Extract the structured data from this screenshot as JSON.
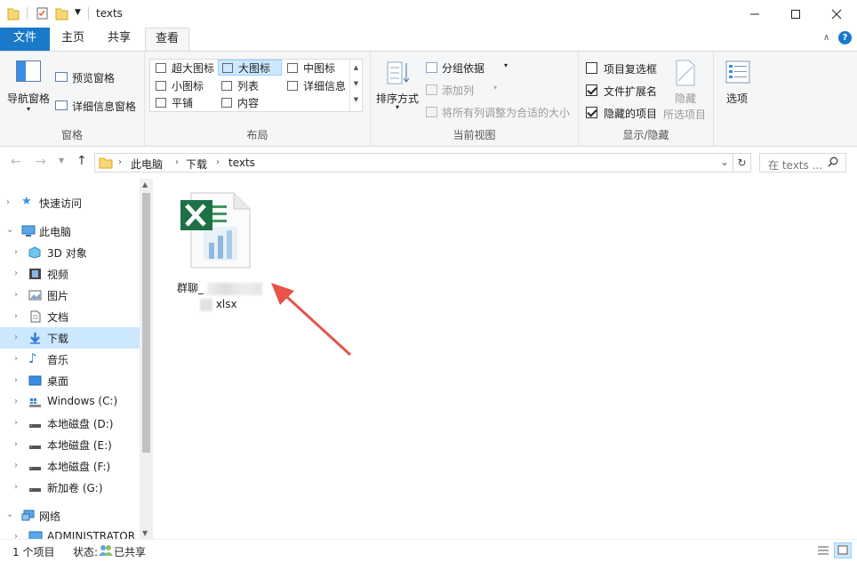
{
  "window": {
    "title": "texts"
  },
  "ribbon_tabs": [
    {
      "label": "文件"
    },
    {
      "label": "主页"
    },
    {
      "label": "共享"
    },
    {
      "label": "查看"
    }
  ],
  "ribbon": {
    "panes": {
      "nav_pane": "导航窗格",
      "preview_pane": "预览窗格",
      "details_pane": "详细信息窗格",
      "group_label": "窗格"
    },
    "layout": {
      "items": [
        "超大图标",
        "大图标",
        "中图标",
        "小图标",
        "列表",
        "详细信息",
        "平铺",
        "内容"
      ],
      "selected": "大图标",
      "group_label": "布局"
    },
    "current_view": {
      "sort_by": "排序方式",
      "group_by": "分组依据",
      "add_column": "添加列",
      "fit_columns": "将所有列调整为合适的大小",
      "group_label": "当前视图"
    },
    "show_hide": {
      "item_checkboxes": "项目复选框",
      "file_extensions": "文件扩展名",
      "hidden_items": "隐藏的项目",
      "hide_selected_1": "隐藏",
      "hide_selected_2": "所选项目",
      "group_label": "显示/隐藏",
      "item_checkboxes_checked": false,
      "file_extensions_checked": true,
      "hidden_items_checked": true
    },
    "options": "选项"
  },
  "address": {
    "crumbs": [
      "此电脑",
      "下载",
      "texts"
    ],
    "search_placeholder": "在 texts ..."
  },
  "sidebar": {
    "items": [
      {
        "label": "快速访问",
        "icon": "star-icon"
      },
      {
        "label": "此电脑",
        "icon": "computer-icon"
      },
      {
        "label": "3D 对象",
        "icon": "cube-icon"
      },
      {
        "label": "视频",
        "icon": "video-icon"
      },
      {
        "label": "图片",
        "icon": "picture-icon"
      },
      {
        "label": "文档",
        "icon": "document-icon"
      },
      {
        "label": "下载",
        "icon": "download-icon"
      },
      {
        "label": "音乐",
        "icon": "music-icon"
      },
      {
        "label": "桌面",
        "icon": "desktop-icon"
      },
      {
        "label": "Windows (C:)",
        "icon": "drive-icon"
      },
      {
        "label": "本地磁盘 (D:)",
        "icon": "drive-icon"
      },
      {
        "label": "本地磁盘 (E:)",
        "icon": "drive-icon"
      },
      {
        "label": "本地磁盘 (F:)",
        "icon": "drive-icon"
      },
      {
        "label": "新加卷 (G:)",
        "icon": "drive-icon"
      },
      {
        "label": "网络",
        "icon": "network-icon"
      },
      {
        "label": "ADMINISTRATOR",
        "icon": "computer-icon"
      }
    ],
    "selected": "下载"
  },
  "files": [
    {
      "name_line1": "群聊_",
      "name_line2": "xlsx",
      "icon": "excel-file-icon"
    }
  ],
  "status": {
    "count": "1 个项目",
    "state": "状态:",
    "shared": "已共享"
  },
  "colors": {
    "accent": "#1979ca",
    "selection": "#cce8ff",
    "annotation": "#e8534a"
  }
}
